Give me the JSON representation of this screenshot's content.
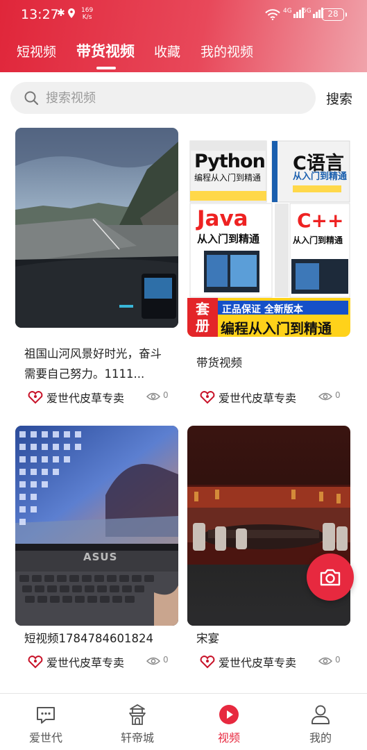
{
  "status_bar": {
    "time": "13:27",
    "speed_value": "169",
    "speed_unit": "K/s",
    "net1": "4G",
    "net2": "5G",
    "battery": "28"
  },
  "tabs": [
    {
      "label": "短视频",
      "active": false
    },
    {
      "label": "带货视频",
      "active": true
    },
    {
      "label": "收藏",
      "active": false
    },
    {
      "label": "我的视频",
      "active": false
    }
  ],
  "search": {
    "placeholder": "搜索视频",
    "value": "",
    "button_label": "搜索"
  },
  "videos": [
    {
      "title": "祖国山河风景好时光，奋斗需要自己努力。1111...",
      "shop": "爱世代皮草专卖",
      "views": "0",
      "thumb": "road"
    },
    {
      "title": "带货视频",
      "shop": "爱世代皮草专卖",
      "views": "0",
      "thumb": "books"
    },
    {
      "title": "短视频1784784601824",
      "shop": "爱世代皮草专卖",
      "views": "0",
      "thumb": "laptop"
    },
    {
      "title": "宋宴",
      "shop": "爱世代皮草专卖",
      "views": "0",
      "thumb": "restaurant"
    }
  ],
  "book_covers": {
    "python": "Python",
    "python_sub": "编程从入门到精通",
    "c": "C语言",
    "c_sub": "从入门到精通",
    "java": "Java",
    "java_sub": "从入门到精通",
    "cpp": "C++",
    "cpp_sub": "从入门到精通",
    "banner_badge": "套册",
    "banner_line1": "正品保证  全新版本",
    "banner_line2": "编程从入门到精通"
  },
  "laptop_brand": "ASUS",
  "bottom_nav": [
    {
      "label": "爱世代",
      "icon": "chat-icon",
      "active": false
    },
    {
      "label": "轩帝城",
      "icon": "palace-icon",
      "active": false
    },
    {
      "label": "视频",
      "icon": "video-play-icon",
      "active": true
    },
    {
      "label": "我的",
      "icon": "person-icon",
      "active": false
    }
  ],
  "colors": {
    "accent": "#e7293f",
    "header_gradient_start": "#e0263a",
    "header_gradient_end": "#f0a3ab"
  }
}
